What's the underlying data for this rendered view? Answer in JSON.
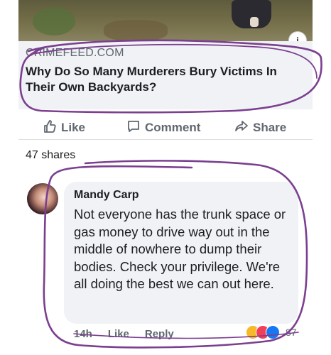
{
  "link_preview": {
    "domain": "CRIMEFEED.COM",
    "title": "Why Do So Many Murderers Bury Victims In Their Own Backyards?",
    "info_icon": "info-icon"
  },
  "actions": {
    "like": "Like",
    "comment": "Comment",
    "share": "Share"
  },
  "shares_count": "47 shares",
  "comment": {
    "author": "Mandy Carp",
    "text": "Not everyone has the trunk space or gas money to drive way out in the middle of nowhere to dump their bodies. Check your privilege. We're all doing the best we can out here.",
    "time": "14h",
    "like": "Like",
    "reply": "Reply",
    "reaction_count": "87",
    "reaction_icons": [
      "haha-icon",
      "love-icon",
      "like-icon"
    ]
  },
  "colors": {
    "annotation": "#7b3f8f",
    "bubble": "#f0f2f5",
    "secondary_text": "#606770"
  }
}
